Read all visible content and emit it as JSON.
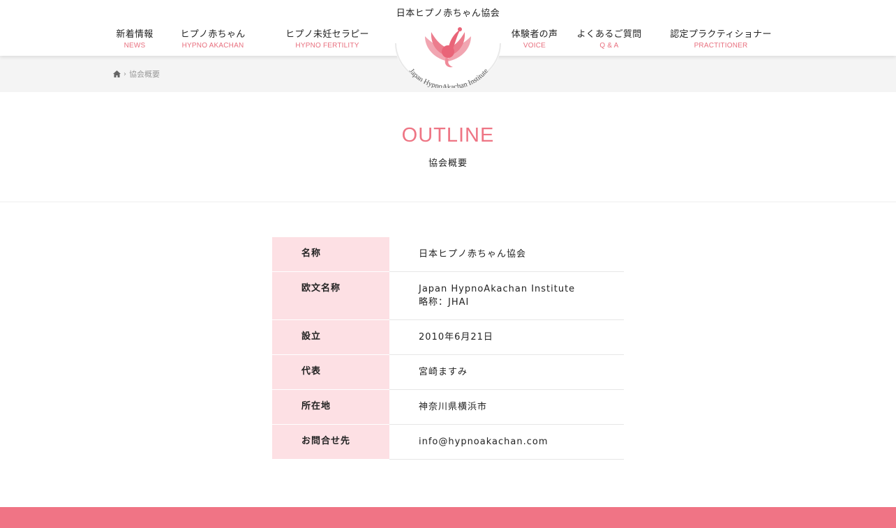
{
  "header": {
    "site_title": "日本ヒプノ赤ちゃん協会",
    "logo_text": "Japan HypnoAkachan Institute",
    "nav_left": [
      {
        "jp": "新着情報",
        "en": "NEWS"
      },
      {
        "jp": "ヒプノ赤ちゃん",
        "en": "HYPNO AKACHAN"
      },
      {
        "jp": "ヒプノ未妊セラピー",
        "en": "HYPNO FERTILITY"
      }
    ],
    "nav_right": [
      {
        "jp": "体験者の声",
        "en": "VOICE"
      },
      {
        "jp": "よくあるご質問",
        "en": "Q & A"
      },
      {
        "jp": "認定プラクティショナー",
        "en": "PRACTITIONER"
      }
    ]
  },
  "breadcrumb": {
    "home_icon": "home-icon",
    "current": "協会概要"
  },
  "page": {
    "title": "OUTLINE",
    "subtitle": "協会概要"
  },
  "table": {
    "rows": [
      {
        "label": "名称",
        "values": [
          "日本ヒプノ赤ちゃん協会"
        ]
      },
      {
        "label": "欧文名称",
        "values": [
          "Japan HypnoAkachan Institute",
          "略称：JHAI"
        ]
      },
      {
        "label": "設立",
        "values": [
          "2010年6月21日"
        ]
      },
      {
        "label": "代表",
        "values": [
          "宮崎ますみ"
        ]
      },
      {
        "label": "所在地",
        "values": [
          "神奈川県横浜市"
        ]
      },
      {
        "label": "お問合せ先",
        "values": [
          "info@hypnoakachan.com"
        ]
      }
    ]
  },
  "colors": {
    "accent": "#ee7584",
    "label_bg": "#fde0e4",
    "footer": "#f07485"
  }
}
